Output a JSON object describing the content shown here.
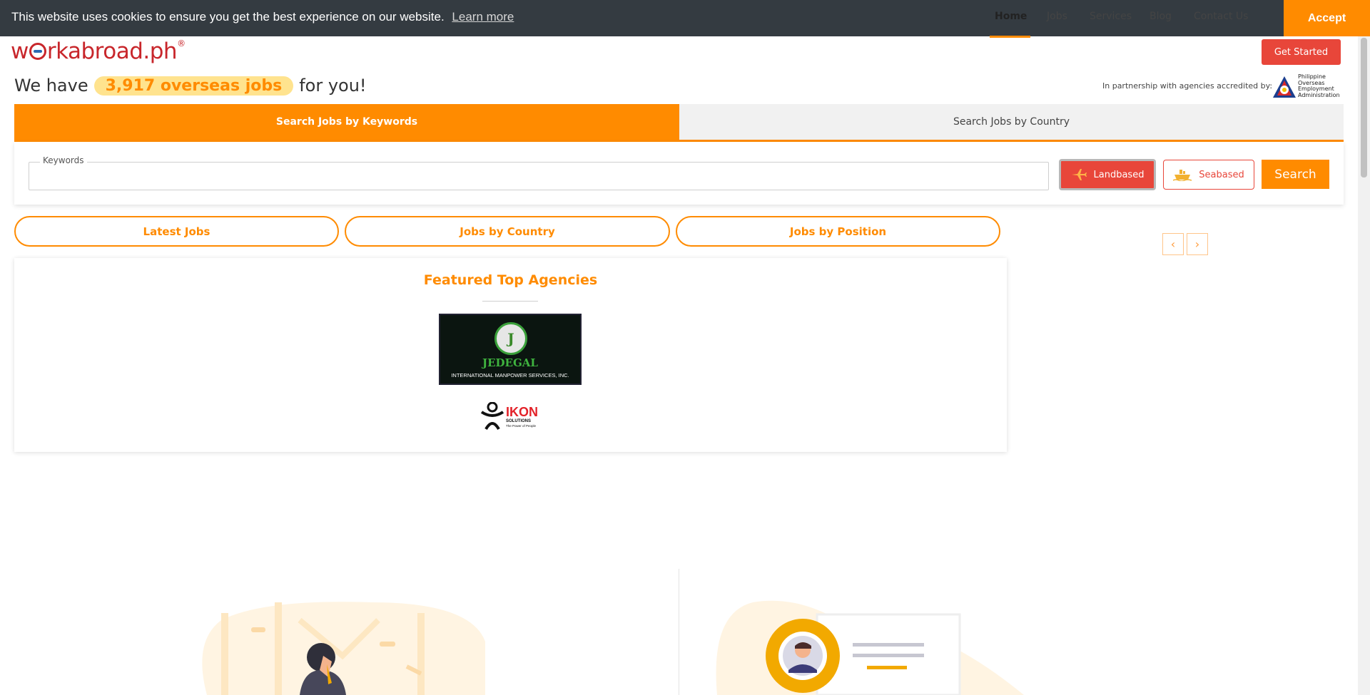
{
  "cookie": {
    "message": "This website uses cookies to ensure you get the best experience on our website.",
    "learn_more": "Learn more",
    "accept": "Accept"
  },
  "brand": {
    "logo_pre": "w",
    "logo_post": "rkabroad.ph",
    "logo_mark": "®"
  },
  "nav": {
    "items": [
      {
        "label": "Home"
      },
      {
        "label": "Jobs"
      },
      {
        "label": "Services"
      },
      {
        "label": "Blog"
      },
      {
        "label": "Contact Us"
      }
    ],
    "cta": "Get Started"
  },
  "headline": {
    "prefix": "We have",
    "highlight": "3,917 overseas jobs",
    "suffix": "for you!"
  },
  "partner": {
    "text": "In partnership with agencies accredited by:",
    "poea_lines": [
      "Philippine",
      "Overseas",
      "Employment",
      "Administration"
    ]
  },
  "search": {
    "tabs": [
      "Search Jobs by Keywords",
      "Search Jobs by Country"
    ],
    "keywords_label": "Keywords",
    "keywords_value": "",
    "landbased": "Landbased",
    "seabased": "Seabased",
    "search_button": "Search"
  },
  "quick_links": [
    "Latest Jobs",
    "Jobs by Country",
    "Jobs by Position"
  ],
  "carousel": {
    "prev": "‹",
    "next": "›"
  },
  "featured": {
    "title": "Featured Top Agencies",
    "agencies": [
      {
        "name": "JEDEGAL",
        "subtitle": "INTERNATIONAL MANPOWER SERVICES, INC.",
        "mark": "J"
      },
      {
        "name": "IKON",
        "subtitle": "SOLUTIONS",
        "tagline": "The Power of People"
      }
    ]
  },
  "colors": {
    "accent": "#ff8b00",
    "brand_red": "#c8262b",
    "cta_red": "#e8463a",
    "cookie_bg": "#343b41",
    "highlight_bg": "#ffe38e"
  },
  "icons": {
    "landbased": "airplane-icon",
    "seabased": "ship-icon",
    "prev": "chevron-left-icon",
    "next": "chevron-right-icon"
  }
}
